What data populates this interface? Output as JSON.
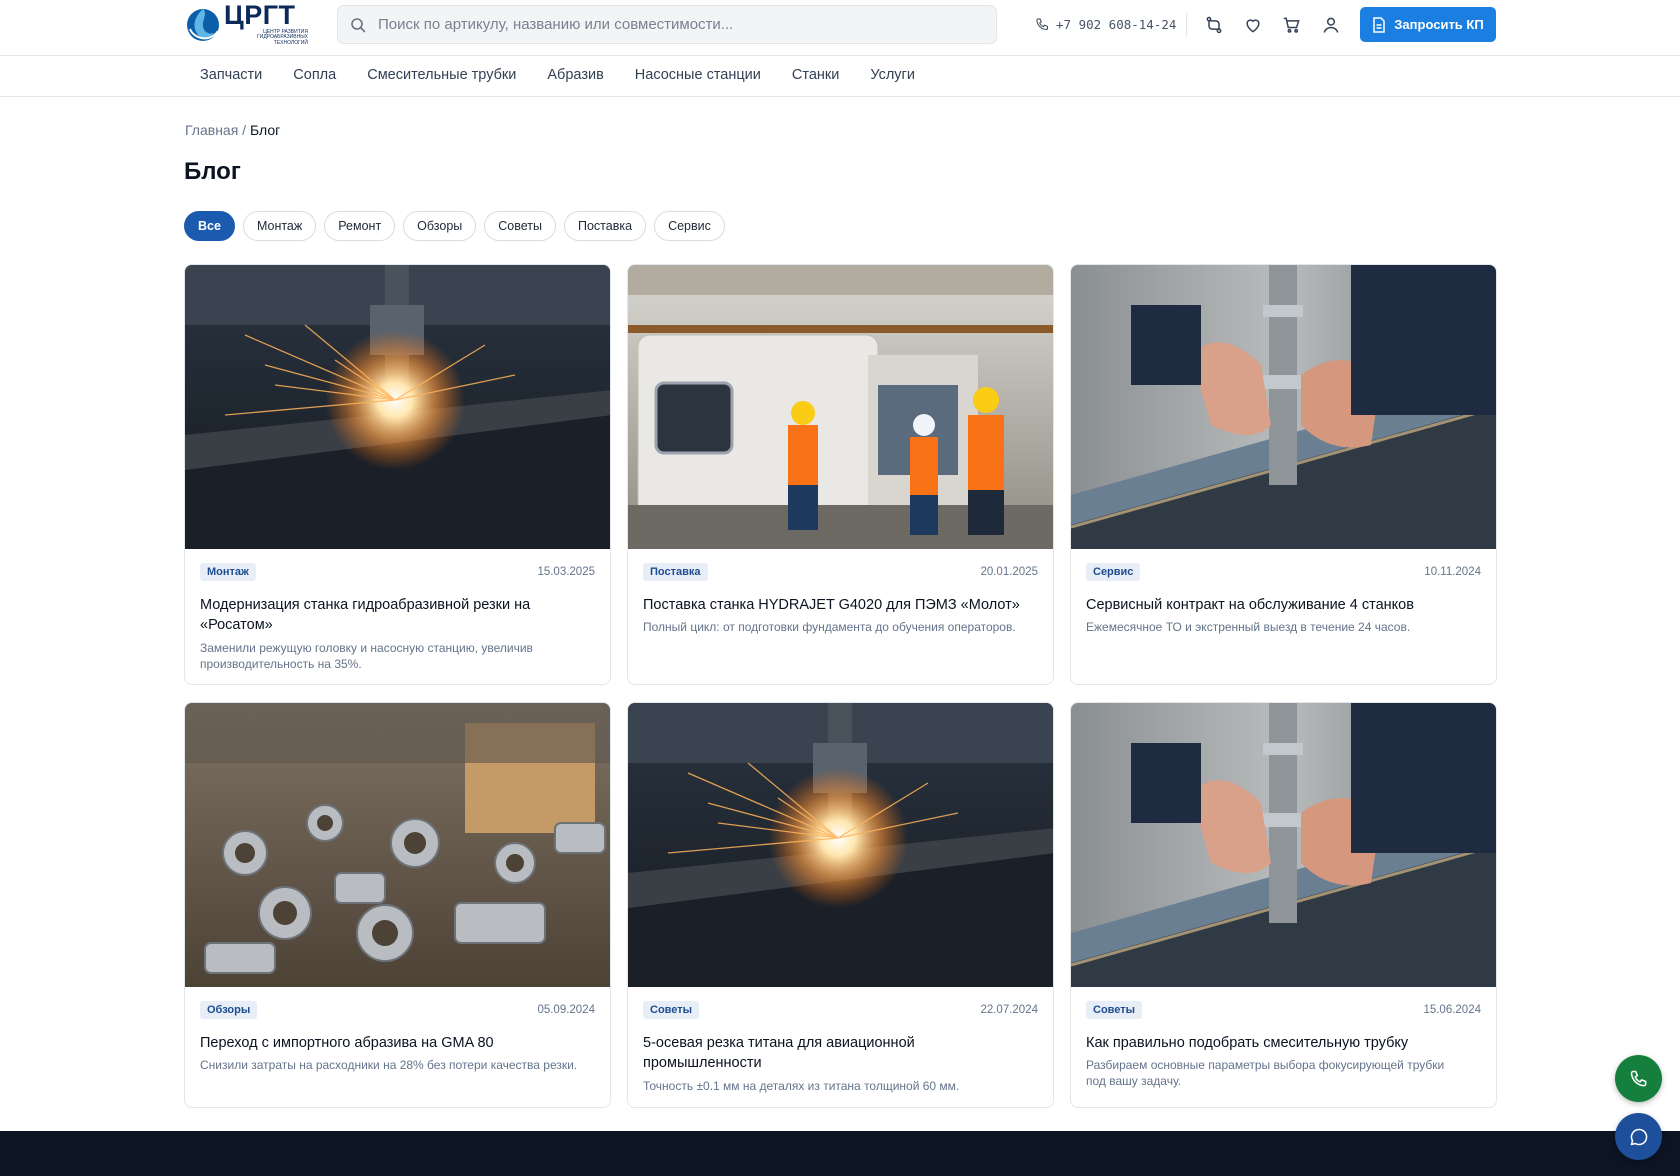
{
  "header": {
    "logo_title": "ЦРГТ",
    "logo_sub_1": "ЦЕНТР РАЗВИТИЯ",
    "logo_sub_2": "ГИДРОАБРАЗИВНЫХ ТЕХНОЛОГИЙ",
    "search_placeholder": "Поиск по артикулу, названию или совместимости...",
    "phone": "+7 902 608-14-24",
    "cta_label": "Запросить КП",
    "icons": [
      "compare-icon",
      "heart-icon",
      "cart-icon",
      "user-icon"
    ]
  },
  "nav": {
    "items": [
      "Запчасти",
      "Сопла",
      "Смесительные трубки",
      "Абразив",
      "Насосные станции",
      "Станки",
      "Услуги"
    ]
  },
  "breadcrumb": {
    "home": "Главная",
    "sep": " / ",
    "current": "Блог"
  },
  "page_title": "Блог",
  "filters": [
    "Все",
    "Монтаж",
    "Ремонт",
    "Обзоры",
    "Советы",
    "Поставка",
    "Сервис"
  ],
  "active_filter": "Все",
  "posts": [
    {
      "tag": "Монтаж",
      "date": "15.03.2025",
      "title": "Модернизация станка гидроабразивной резки на «Росатом»",
      "desc": "Заменили режущую головку и насосную станцию, увеличив производительность на 35%.",
      "image": "sparks-cutting"
    },
    {
      "tag": "Поставка",
      "date": "20.01.2025",
      "title": "Поставка станка HYDRAJET G4020 для ПЭМЗ «Молот»",
      "desc": "Полный цикл: от подготовки фундамента до обучения операторов.",
      "image": "workers-machine"
    },
    {
      "tag": "Сервис",
      "date": "10.11.2024",
      "title": "Сервисный контракт на обслуживание 4 станков",
      "desc": "Ежемесячное ТО и экстренный выезд в течение 24 часов.",
      "image": "hands-nozzle"
    },
    {
      "tag": "Обзоры",
      "date": "05.09.2024",
      "title": "Переход с импортного абразива на GMA 80",
      "desc": "Снизили затраты на расходники на 28% без потери качества резки.",
      "image": "metal-parts"
    },
    {
      "tag": "Советы",
      "date": "22.07.2024",
      "title": "5-осевая резка титана для авиационной промышленности",
      "desc": "Точность ±0.1 мм на деталях из титана толщиной 60 мм.",
      "image": "sparks-cutting"
    },
    {
      "tag": "Советы",
      "date": "15.06.2024",
      "title": "Как правильно подобрать смесительную трубку",
      "desc": "Разбираем основные параметры выбора фокусирующей трубки под вашу задачу.",
      "image": "hands-nozzle"
    }
  ],
  "colors": {
    "primary": "#1a7fe0",
    "active_chip": "#1a5bb0",
    "footer": "#0d1424",
    "fab_phone": "#15803d",
    "fab_chat": "#1d4f9a"
  }
}
